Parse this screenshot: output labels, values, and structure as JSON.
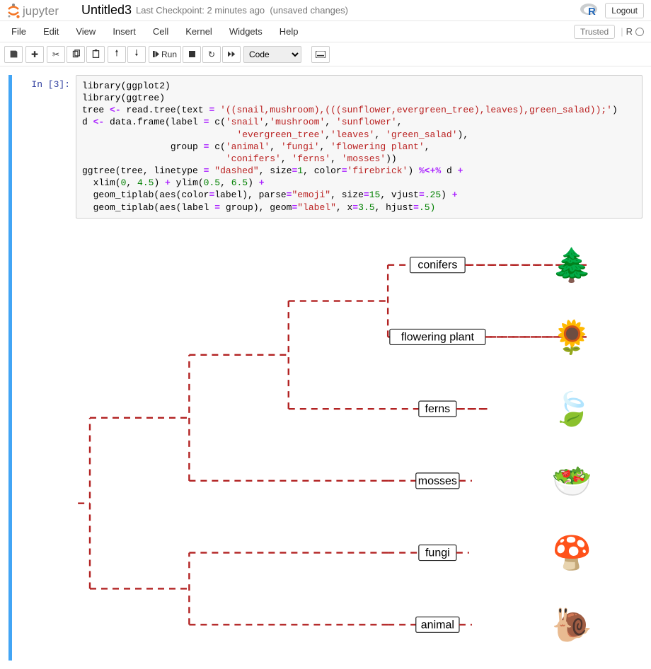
{
  "header": {
    "notebook_name": "Untitled3",
    "checkpoint": "Last Checkpoint: 2 minutes ago",
    "autosave": "(unsaved changes)",
    "logout": "Logout"
  },
  "menu": {
    "items": [
      "File",
      "Edit",
      "View",
      "Insert",
      "Cell",
      "Kernel",
      "Widgets",
      "Help"
    ],
    "trusted": "Trusted",
    "kernel_name": "R"
  },
  "toolbar": {
    "run_label": "Run",
    "cell_type": "Code"
  },
  "cell": {
    "prompt": "In [3]:",
    "code_tokens": [
      [
        "library(ggplot2)\nlibrary(ggtree)\ntree ",
        "n"
      ],
      [
        "<-",
        "o"
      ],
      [
        " read.tree(text ",
        "n"
      ],
      [
        "=",
        "o"
      ],
      [
        " ",
        "n"
      ],
      [
        "'((snail,mushroom),(((sunflower,evergreen_tree),leaves),green_salad));'",
        "s"
      ],
      [
        ")\nd ",
        "n"
      ],
      [
        "<-",
        "o"
      ],
      [
        " data.frame(label ",
        "n"
      ],
      [
        "=",
        "o"
      ],
      [
        " c(",
        "n"
      ],
      [
        "'snail'",
        "s"
      ],
      [
        ",",
        "n"
      ],
      [
        "'mushroom'",
        "s"
      ],
      [
        ", ",
        "n"
      ],
      [
        "'sunflower'",
        "s"
      ],
      [
        ",\n                            ",
        "n"
      ],
      [
        "'evergreen_tree'",
        "s"
      ],
      [
        ",",
        "n"
      ],
      [
        "'leaves'",
        "s"
      ],
      [
        ", ",
        "n"
      ],
      [
        "'green_salad'",
        "s"
      ],
      [
        "),\n                group ",
        "n"
      ],
      [
        "=",
        "o"
      ],
      [
        " c(",
        "n"
      ],
      [
        "'animal'",
        "s"
      ],
      [
        ", ",
        "n"
      ],
      [
        "'fungi'",
        "s"
      ],
      [
        ", ",
        "n"
      ],
      [
        "'flowering plant'",
        "s"
      ],
      [
        ",\n                          ",
        "n"
      ],
      [
        "'conifers'",
        "s"
      ],
      [
        ", ",
        "n"
      ],
      [
        "'ferns'",
        "s"
      ],
      [
        ", ",
        "n"
      ],
      [
        "'mosses'",
        "s"
      ],
      [
        "))\nggtree(tree, linetype ",
        "n"
      ],
      [
        "=",
        "o"
      ],
      [
        " ",
        "n"
      ],
      [
        "\"dashed\"",
        "s"
      ],
      [
        ", size",
        "n"
      ],
      [
        "=",
        "o"
      ],
      [
        "1",
        "m"
      ],
      [
        ", color",
        "n"
      ],
      [
        "=",
        "o"
      ],
      [
        "'firebrick'",
        "s"
      ],
      [
        ") ",
        "n"
      ],
      [
        "%<+%",
        "o"
      ],
      [
        " d ",
        "n"
      ],
      [
        "+",
        "o"
      ],
      [
        "\n  xlim(",
        "n"
      ],
      [
        "0",
        "m"
      ],
      [
        ", ",
        "n"
      ],
      [
        "4.5",
        "m"
      ],
      [
        ") ",
        "n"
      ],
      [
        "+",
        "o"
      ],
      [
        " ylim(",
        "n"
      ],
      [
        "0.5",
        "m"
      ],
      [
        ", ",
        "n"
      ],
      [
        "6.5",
        "m"
      ],
      [
        ") ",
        "n"
      ],
      [
        "+",
        "o"
      ],
      [
        "\n  geom_tiplab(aes(color",
        "n"
      ],
      [
        "=",
        "o"
      ],
      [
        "label), parse",
        "n"
      ],
      [
        "=",
        "o"
      ],
      [
        "\"emoji\"",
        "s"
      ],
      [
        ", size",
        "n"
      ],
      [
        "=",
        "o"
      ],
      [
        "15",
        "m"
      ],
      [
        ", vjust",
        "n"
      ],
      [
        "=",
        "o"
      ],
      [
        ".25",
        "m"
      ],
      [
        ") ",
        "n"
      ],
      [
        "+",
        "o"
      ],
      [
        "\n  geom_tiplab(aes(label ",
        "n"
      ],
      [
        "=",
        "o"
      ],
      [
        " group), geom",
        "n"
      ],
      [
        "=",
        "o"
      ],
      [
        "\"label\"",
        "s"
      ],
      [
        ", x",
        "n"
      ],
      [
        "=",
        "o"
      ],
      [
        "3.5",
        "m"
      ],
      [
        ", hjust",
        "n"
      ],
      [
        "=",
        "o"
      ],
      [
        ".5)",
        "m"
      ]
    ]
  },
  "chart_data": {
    "type": "tree",
    "newick": "((snail,mushroom),(((sunflower,evergreen_tree),leaves),green_salad));",
    "linetype": "dashed",
    "color": "firebrick",
    "xlim": [
      0,
      4.5
    ],
    "ylim": [
      0.5,
      6.5
    ],
    "tiplab_x": 3.5,
    "tips": [
      {
        "label": "snail",
        "group": "animal",
        "emoji": "🐌",
        "x": 3,
        "y": 1
      },
      {
        "label": "mushroom",
        "group": "fungi",
        "emoji": "🍄",
        "x": 3,
        "y": 2
      },
      {
        "label": "green_salad",
        "group": "mosses",
        "emoji": "🥗",
        "x": 3,
        "y": 3
      },
      {
        "label": "leaves",
        "group": "ferns",
        "emoji": "🍃",
        "x": 4,
        "y": 4
      },
      {
        "label": "sunflower",
        "group": "flowering plant",
        "emoji": "🌻",
        "x": 5,
        "y": 5
      },
      {
        "label": "evergreen_tree",
        "group": "conifers",
        "emoji": "🌲",
        "x": 5,
        "y": 6
      }
    ],
    "internal_nodes": [
      {
        "id": "root",
        "x": 0,
        "children": [
          "n1",
          "n2"
        ],
        "y": null
      },
      {
        "id": "n1",
        "x": 1,
        "children": [
          "snail",
          "mushroom"
        ],
        "y": null
      },
      {
        "id": "n2",
        "x": 1,
        "children": [
          "n3",
          "green_salad"
        ],
        "y": null
      },
      {
        "id": "n3",
        "x": 2,
        "children": [
          "n4",
          "leaves"
        ],
        "y": null
      },
      {
        "id": "n4",
        "x": 3,
        "children": [
          "sunflower",
          "evergreen_tree"
        ],
        "y": null
      }
    ]
  }
}
